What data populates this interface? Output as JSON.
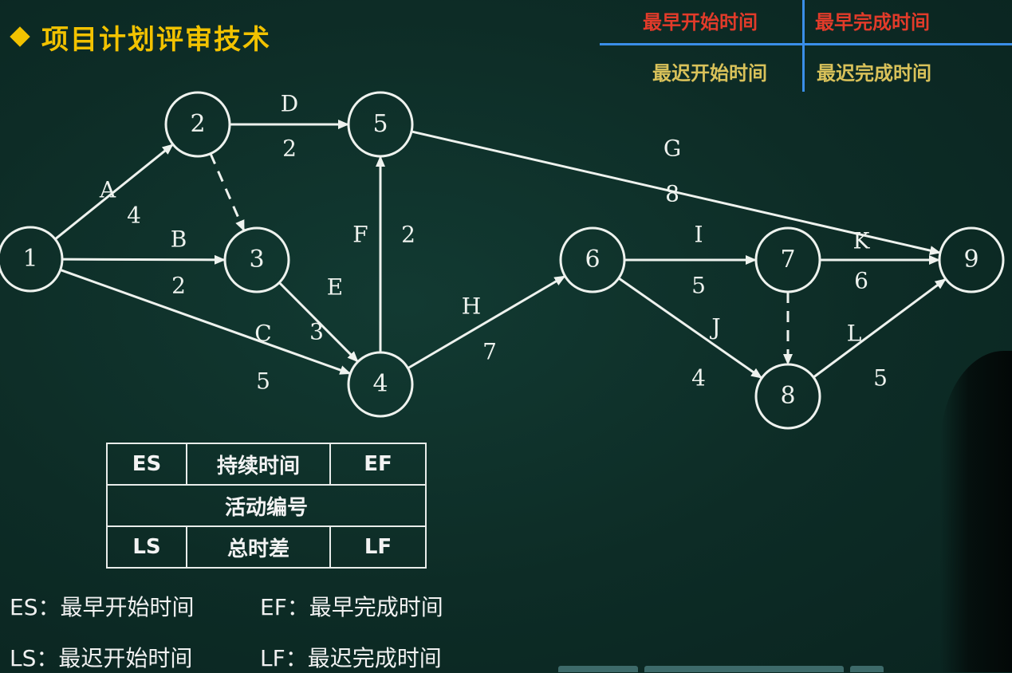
{
  "title": "项目计划评审技术",
  "colors": {
    "title": "#f2c200",
    "earliest": "#e23b2a",
    "latest": "#d9c25a",
    "legend_line": "#3a8ee8",
    "arrow": "#eef2ee"
  },
  "legend_top": {
    "es": "最早开始时间",
    "ef": "最早完成时间",
    "ls": "最迟开始时间",
    "lf": "最迟完成时间"
  },
  "nodes": [
    "1",
    "2",
    "3",
    "4",
    "5",
    "6",
    "7",
    "8",
    "9"
  ],
  "activities": [
    {
      "from": "1",
      "to": "2",
      "name": "A",
      "duration": "4"
    },
    {
      "from": "1",
      "to": "3",
      "name": "B",
      "duration": "2"
    },
    {
      "from": "1",
      "to": "4",
      "name": "C",
      "duration": "5"
    },
    {
      "from": "2",
      "to": "5",
      "name": "D",
      "duration": "2"
    },
    {
      "from": "2",
      "to": "3",
      "name": "",
      "duration": "",
      "dummy": true
    },
    {
      "from": "3",
      "to": "4",
      "name": "E",
      "duration": "3"
    },
    {
      "from": "4",
      "to": "5",
      "name": "F",
      "duration": "2"
    },
    {
      "from": "5",
      "to": "9",
      "name": "G",
      "duration": "8"
    },
    {
      "from": "4",
      "to": "6",
      "name": "H",
      "duration": "7"
    },
    {
      "from": "6",
      "to": "7",
      "name": "I",
      "duration": "5"
    },
    {
      "from": "6",
      "to": "8",
      "name": "J",
      "duration": "4"
    },
    {
      "from": "7",
      "to": "9",
      "name": "K",
      "duration": "6"
    },
    {
      "from": "7",
      "to": "8",
      "name": "",
      "duration": "",
      "dummy": true
    },
    {
      "from": "8",
      "to": "9",
      "name": "L",
      "duration": "5"
    }
  ],
  "legend_box": {
    "es": "ES",
    "duration": "持续时间",
    "ef": "EF",
    "activity_id": "活动编号",
    "ls": "LS",
    "total_float": "总时差",
    "lf": "LF"
  },
  "notes": {
    "es": "ES：最早开始时间",
    "ef": "EF：最早完成时间",
    "ls": "LS：最迟开始时间",
    "lf": "LF：最迟完成时间"
  }
}
